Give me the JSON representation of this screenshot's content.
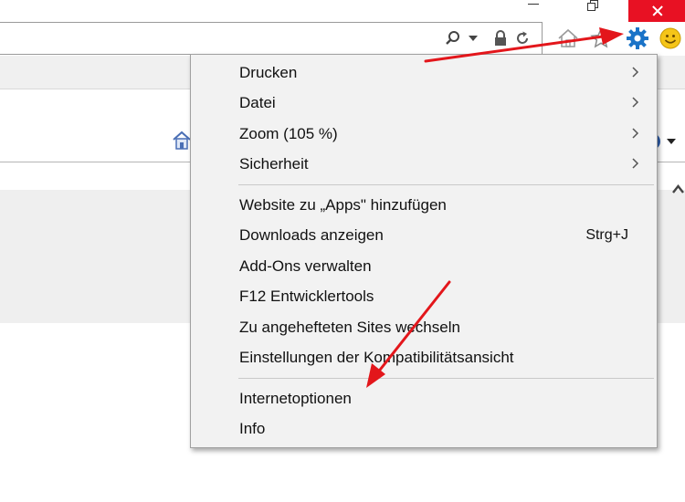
{
  "window_controls": [
    "minimize-icon",
    "restore-icon",
    "close-icon"
  ],
  "address_bar": {
    "icons": [
      "search-icon",
      "dropdown-arrow-icon",
      "lock-icon",
      "refresh-icon"
    ]
  },
  "nav_icons": [
    "home-icon",
    "favorites-star-icon",
    "settings-gear-icon",
    "smiley-feedback-icon"
  ],
  "colors": {
    "close_button": "#e81123",
    "gear": "#1a73c7",
    "smiley": "#f5c518",
    "annotation_arrow": "#e3161b",
    "menu_background": "#f2f2f2"
  },
  "menu": {
    "group1": [
      {
        "label": "Drucken",
        "submenu": true
      },
      {
        "label": "Datei",
        "submenu": true
      },
      {
        "label": "Zoom (105 %)",
        "submenu": true
      },
      {
        "label": "Sicherheit",
        "submenu": true
      }
    ],
    "group2": [
      {
        "label": "Website zu „Apps\" hinzufügen"
      },
      {
        "label": "Downloads anzeigen",
        "shortcut": "Strg+J"
      },
      {
        "label": "Add-Ons verwalten"
      },
      {
        "label": "F12 Entwicklertools"
      },
      {
        "label": "Zu angehefteten Sites wechseln"
      },
      {
        "label": "Einstellungen der Kompatibilitätsansicht"
      }
    ],
    "group3": [
      {
        "label": "Internetoptionen"
      },
      {
        "label": "Info"
      }
    ]
  }
}
